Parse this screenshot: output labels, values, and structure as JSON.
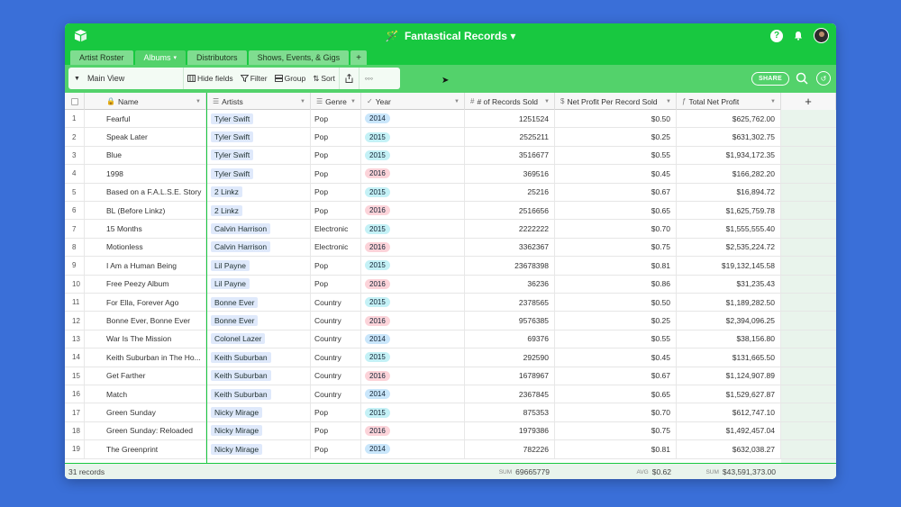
{
  "app": {
    "base_title": "Fantastical Records",
    "title_caret": "▾",
    "wand": "🪄"
  },
  "tabs": [
    {
      "label": "Artist Roster",
      "active": false
    },
    {
      "label": "Albums",
      "active": true,
      "caret": "▾"
    },
    {
      "label": "Distributors",
      "active": false
    },
    {
      "label": "Shows, Events, & Gigs",
      "active": false
    }
  ],
  "add_tab_label": "+",
  "toolbar": {
    "view_name": "Main View",
    "hide_fields": "Hide fields",
    "filter": "Filter",
    "group": "Group",
    "sort": "Sort",
    "more": "◦◦◦",
    "share": "SHARE"
  },
  "columns": [
    {
      "label": "Name",
      "icon": "key-icon",
      "glyph": "🔒"
    },
    {
      "label": "Artists",
      "icon": "link-icon",
      "glyph": "☰"
    },
    {
      "label": "Genre",
      "icon": "text-icon",
      "glyph": "☰"
    },
    {
      "label": "Year",
      "icon": "select-icon",
      "glyph": "✓"
    },
    {
      "label": "# of Records Sold",
      "icon": "number-icon",
      "glyph": "#"
    },
    {
      "label": "Net Profit Per Record Sold",
      "icon": "currency-icon",
      "glyph": "$"
    },
    {
      "label": "Total Net Profit",
      "icon": "formula-icon",
      "glyph": "ƒ"
    }
  ],
  "add_column_label": "+",
  "rows": [
    {
      "id": "1",
      "name": "Fearful",
      "artist": "Tyler Swift",
      "genre": "Pop",
      "year": "2014",
      "sold": "1251524",
      "per": "$0.50",
      "total": "$625,762.00"
    },
    {
      "id": "2",
      "name": "Speak Later",
      "artist": "Tyler Swift",
      "genre": "Pop",
      "year": "2015",
      "sold": "2525211",
      "per": "$0.25",
      "total": "$631,302.75"
    },
    {
      "id": "3",
      "name": "Blue",
      "artist": "Tyler Swift",
      "genre": "Pop",
      "year": "2015",
      "sold": "3516677",
      "per": "$0.55",
      "total": "$1,934,172.35"
    },
    {
      "id": "4",
      "name": "1998",
      "artist": "Tyler Swift",
      "genre": "Pop",
      "year": "2016",
      "sold": "369516",
      "per": "$0.45",
      "total": "$166,282.20"
    },
    {
      "id": "5",
      "name": "Based on a F.A.L.S.E. Story",
      "artist": "2 Linkz",
      "genre": "Pop",
      "year": "2015",
      "sold": "25216",
      "per": "$0.67",
      "total": "$16,894.72"
    },
    {
      "id": "6",
      "name": "BL (Before Linkz)",
      "artist": "2 Linkz",
      "genre": "Pop",
      "year": "2016",
      "sold": "2516656",
      "per": "$0.65",
      "total": "$1,625,759.78"
    },
    {
      "id": "7",
      "name": "15 Months",
      "artist": "Calvin Harrison",
      "genre": "Electronic",
      "year": "2015",
      "sold": "2222222",
      "per": "$0.70",
      "total": "$1,555,555.40"
    },
    {
      "id": "8",
      "name": "Motionless",
      "artist": "Calvin Harrison",
      "genre": "Electronic",
      "year": "2016",
      "sold": "3362367",
      "per": "$0.75",
      "total": "$2,535,224.72"
    },
    {
      "id": "9",
      "name": "I Am a Human Being",
      "artist": "Lil Payne",
      "genre": "Pop",
      "year": "2015",
      "sold": "23678398",
      "per": "$0.81",
      "total": "$19,132,145.58"
    },
    {
      "id": "10",
      "name": "Free Peezy Album",
      "artist": "Lil Payne",
      "genre": "Pop",
      "year": "2016",
      "sold": "36236",
      "per": "$0.86",
      "total": "$31,235.43"
    },
    {
      "id": "11",
      "name": "For Ella, Forever Ago",
      "artist": "Bonne Ever",
      "genre": "Country",
      "year": "2015",
      "sold": "2378565",
      "per": "$0.50",
      "total": "$1,189,282.50"
    },
    {
      "id": "12",
      "name": "Bonne Ever, Bonne Ever",
      "artist": "Bonne Ever",
      "genre": "Country",
      "year": "2016",
      "sold": "9576385",
      "per": "$0.25",
      "total": "$2,394,096.25"
    },
    {
      "id": "13",
      "name": "War Is The Mission",
      "artist": "Colonel Lazer",
      "genre": "Country",
      "year": "2014",
      "sold": "69376",
      "per": "$0.55",
      "total": "$38,156.80"
    },
    {
      "id": "14",
      "name": "Keith Suburban in The Ho...",
      "artist": "Keith Suburban",
      "genre": "Country",
      "year": "2015",
      "sold": "292590",
      "per": "$0.45",
      "total": "$131,665.50"
    },
    {
      "id": "15",
      "name": "Get Farther",
      "artist": "Keith Suburban",
      "genre": "Country",
      "year": "2016",
      "sold": "1678967",
      "per": "$0.67",
      "total": "$1,124,907.89"
    },
    {
      "id": "16",
      "name": "Match",
      "artist": "Keith Suburban",
      "genre": "Country",
      "year": "2014",
      "sold": "2367845",
      "per": "$0.65",
      "total": "$1,529,627.87"
    },
    {
      "id": "17",
      "name": "Green Sunday",
      "artist": "Nicky Mirage",
      "genre": "Pop",
      "year": "2015",
      "sold": "875353",
      "per": "$0.70",
      "total": "$612,747.10"
    },
    {
      "id": "18",
      "name": "Green Sunday: Reloaded",
      "artist": "Nicky Mirage",
      "genre": "Pop",
      "year": "2016",
      "sold": "1979386",
      "per": "$0.75",
      "total": "$1,492,457.04"
    },
    {
      "id": "19",
      "name": "The Greenprint",
      "artist": "Nicky Mirage",
      "genre": "Pop",
      "year": "2014",
      "sold": "782226",
      "per": "$0.81",
      "total": "$632,038.27"
    }
  ],
  "footer": {
    "records": "31 records",
    "sum_label": "SUM",
    "sold_sum": "69665779",
    "avg_label": "AVG",
    "per_avg": "$0.62",
    "total_sum_label": "SUM",
    "total_sum": "$43,591,373.00"
  },
  "colors": {
    "brand_green": "#18c840",
    "view_bar_green": "#53d26b",
    "background_blue": "#3a6fd8"
  }
}
